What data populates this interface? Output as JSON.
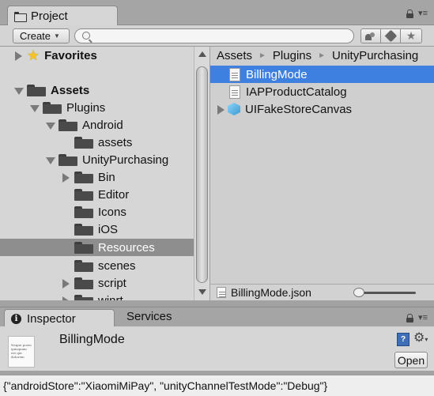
{
  "project": {
    "tab_label": "Project",
    "create_label": "Create",
    "search_placeholder": "",
    "favorites_label": "Favorites",
    "tree": [
      {
        "label": "Assets"
      },
      {
        "label": "Plugins"
      },
      {
        "label": "Android"
      },
      {
        "label": "assets"
      },
      {
        "label": "UnityPurchasing"
      },
      {
        "label": "Bin"
      },
      {
        "label": "Editor"
      },
      {
        "label": "Icons"
      },
      {
        "label": "iOS"
      },
      {
        "label": "Resources"
      },
      {
        "label": "scenes"
      },
      {
        "label": "script"
      },
      {
        "label": "winrt"
      }
    ],
    "breadcrumb": [
      "Assets",
      "Plugins",
      "UnityPurchasing"
    ],
    "assets": [
      {
        "label": "BillingMode"
      },
      {
        "label": "IAPProductCatalog"
      },
      {
        "label": "UIFakeStoreCanvas"
      }
    ],
    "status_file": "BillingMode.json"
  },
  "inspector": {
    "tab_label": "Inspector",
    "services_label": "Services",
    "asset_title": "BillingMode",
    "thumb_text": "Neque porro quisquam est qui dolorem",
    "open_label": "Open",
    "json_preview": "{\"androidStore\":\"XiaomiMiPay\", \"unityChannelTestMode\":\"Debug\"}"
  },
  "colors": {
    "selection_blue": "#3d80df",
    "tree_selected": "#8e8e8e",
    "favorite_star": "#f5c324"
  },
  "icons": {
    "tab": "folder-icon",
    "search": "search-icon",
    "toolbar": [
      "scene-filter-icon",
      "tag-filter-icon",
      "star-filter-icon"
    ],
    "inspector": [
      "info-icon",
      "help-book-icon",
      "gear-icon"
    ]
  }
}
